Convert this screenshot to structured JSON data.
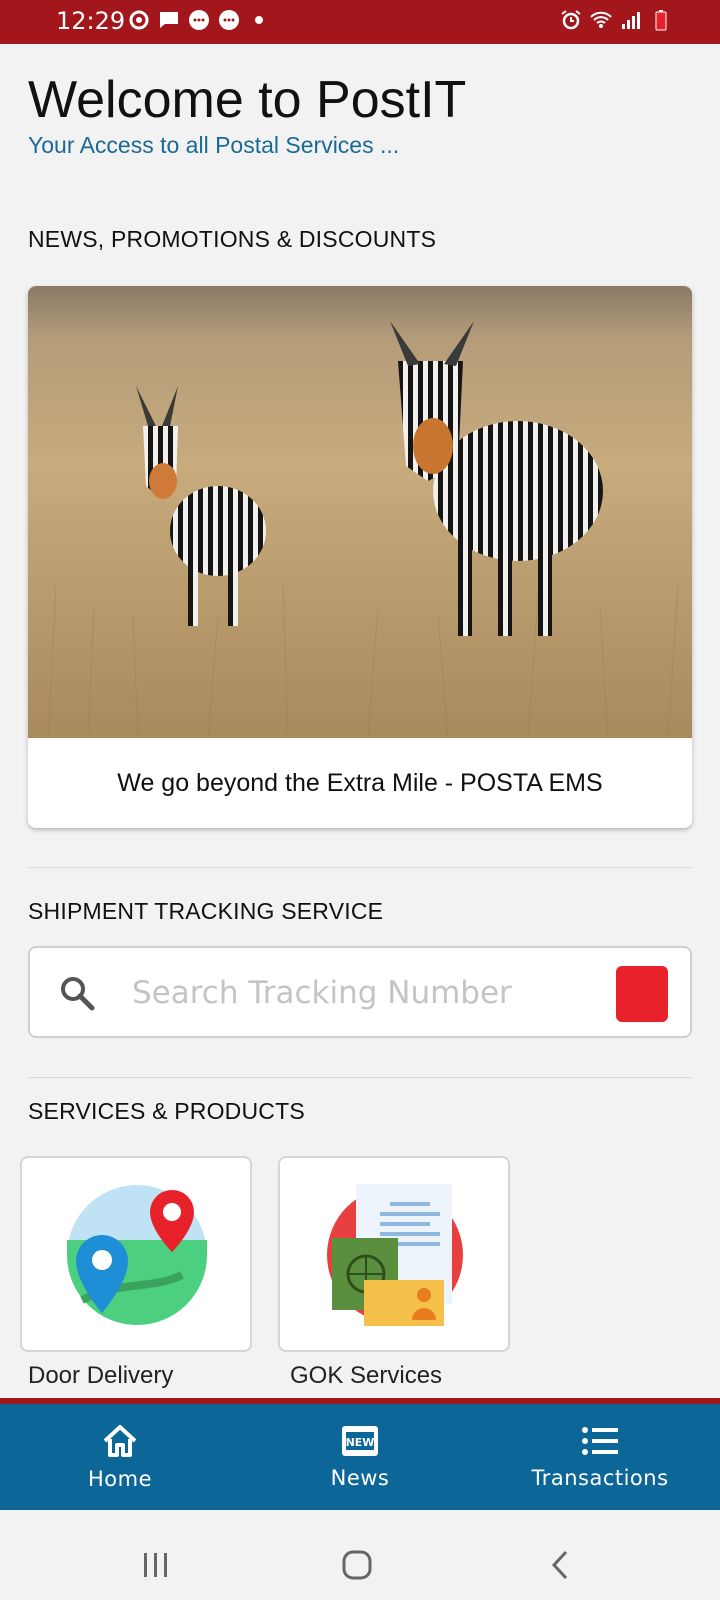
{
  "status_bar": {
    "time": "12:29"
  },
  "header": {
    "title": "Welcome to PostIT",
    "subtitle": "Your Access to all Postal Services ..."
  },
  "news": {
    "heading": "NEWS, PROMOTIONS & DISCOUNTS",
    "card_caption": "We go beyond the Extra Mile - POSTA EMS"
  },
  "tracking": {
    "heading": "SHIPMENT TRACKING SERVICE",
    "placeholder": "Search Tracking Number"
  },
  "services": {
    "heading": "SERVICES & PRODUCTS",
    "items": [
      {
        "label": "Door Delivery"
      },
      {
        "label": "GOK Services"
      }
    ]
  },
  "bottom_nav": [
    {
      "label": "Home"
    },
    {
      "label": "News"
    },
    {
      "label": "Transactions"
    }
  ],
  "colors": {
    "brand_red": "#a3161b",
    "nav_blue": "#0d6698",
    "accent_blue": "#1a6a95",
    "button_red": "#e8222a"
  }
}
